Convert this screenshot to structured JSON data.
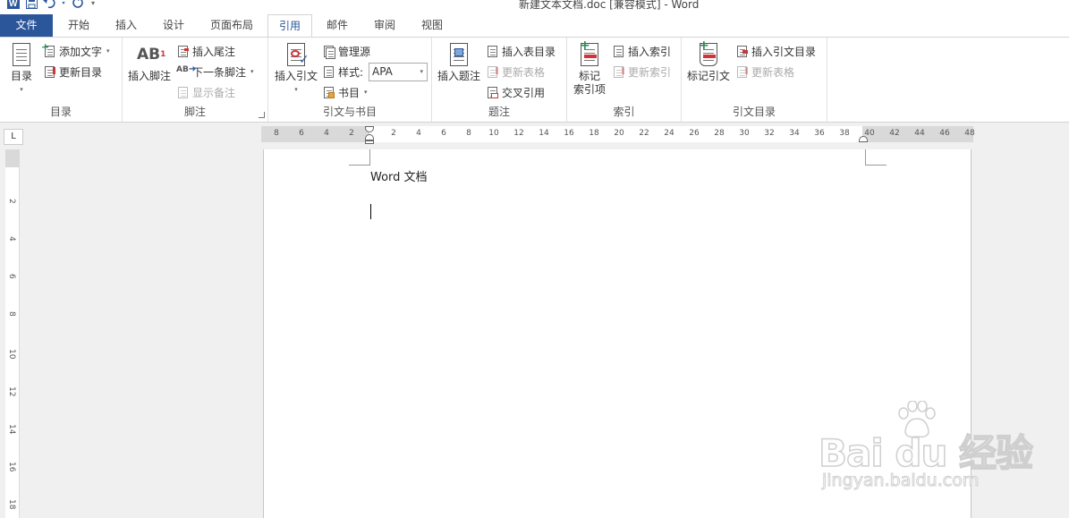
{
  "window": {
    "title": "新建文本文档.doc [兼容模式] - Word"
  },
  "qat": {
    "word_icon": "word-app-icon",
    "save": "save-icon",
    "undo": "undo-icon",
    "redo": "redo-icon",
    "customize": "customize-qat-icon"
  },
  "tabs": [
    {
      "label": "文件"
    },
    {
      "label": "开始"
    },
    {
      "label": "插入"
    },
    {
      "label": "设计"
    },
    {
      "label": "页面布局"
    },
    {
      "label": "引用"
    },
    {
      "label": "邮件"
    },
    {
      "label": "审阅"
    },
    {
      "label": "视图"
    }
  ],
  "active_tab": "引用",
  "ribbon": {
    "toc": {
      "label": "目录",
      "toc_button": "目录",
      "add_text": "添加文字",
      "update_toc": "更新目录"
    },
    "footnotes": {
      "label": "脚注",
      "insert_footnote": "插入脚注",
      "insert_endnote": "插入尾注",
      "next_footnote": "下一条脚注",
      "show_notes": "显示备注",
      "icon_text": "AB"
    },
    "citations": {
      "label": "引文与书目",
      "insert_citation": "插入引文",
      "manage_sources": "管理源",
      "style_label": "样式:",
      "style_value": "APA",
      "bibliography": "书目"
    },
    "captions": {
      "label": "题注",
      "insert_caption": "插入题注",
      "insert_table_of_figures": "插入表目录",
      "update_table": "更新表格",
      "cross_reference": "交叉引用"
    },
    "index": {
      "label": "索引",
      "mark_entry_line1": "标记",
      "mark_entry_line2": "索引项",
      "insert_index": "插入索引",
      "update_index": "更新索引"
    },
    "authorities": {
      "label": "引文目录",
      "mark_citation": "标记引文",
      "insert_toa": "插入引文目录",
      "update_table": "更新表格"
    }
  },
  "ruler": {
    "corner": "L",
    "left_numbers": [
      "8",
      "6",
      "4",
      "2"
    ],
    "right_numbers": [
      "2",
      "4",
      "6",
      "8",
      "10",
      "12",
      "14",
      "16",
      "18",
      "20",
      "22",
      "24",
      "26",
      "28",
      "30",
      "32",
      "34",
      "36",
      "38",
      "40",
      "42",
      "44",
      "46",
      "48"
    ],
    "vertical_numbers": [
      "2",
      "4",
      "6",
      "8",
      "10",
      "12",
      "14",
      "16",
      "18"
    ]
  },
  "document": {
    "text": "Word 文档"
  },
  "watermark": {
    "logo": "Bai  du 经验",
    "url": "jingyan.baidu.com"
  }
}
